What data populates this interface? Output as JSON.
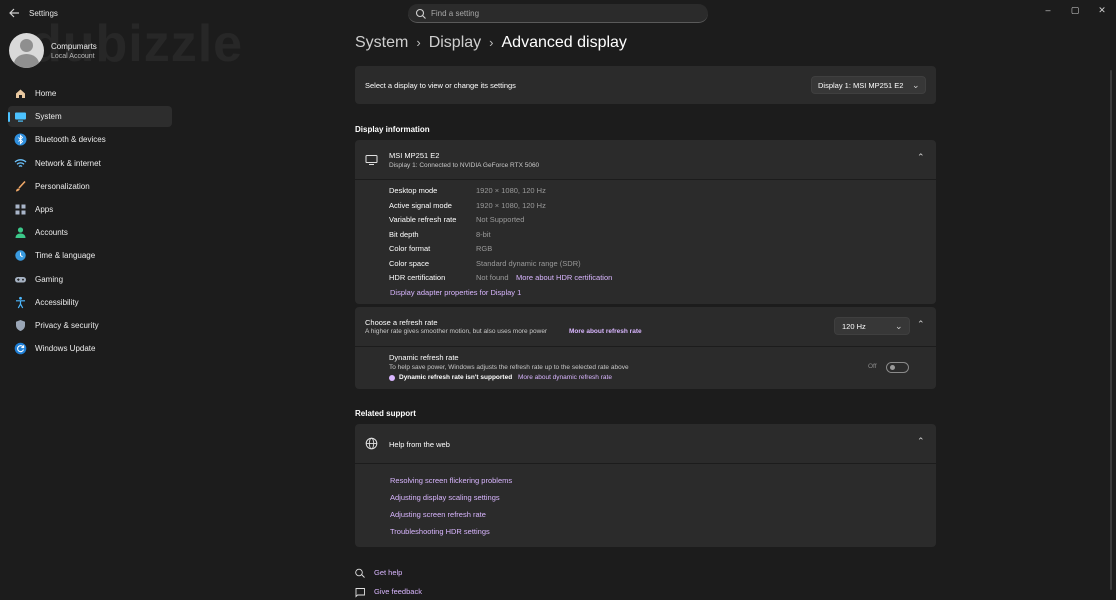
{
  "app": {
    "title": "Settings"
  },
  "search": {
    "placeholder": "Find a setting"
  },
  "window_controls": {
    "minimize": "–",
    "maximize": "▢",
    "close": "✕"
  },
  "watermark": "dubizzle",
  "profile": {
    "name": "Compumarts",
    "account_type": "Local Account"
  },
  "nav": [
    {
      "label": "Home",
      "icon": "home-icon"
    },
    {
      "label": "System",
      "icon": "monitor-icon",
      "active": true
    },
    {
      "label": "Bluetooth & devices",
      "icon": "bluetooth-icon"
    },
    {
      "label": "Network & internet",
      "icon": "wifi-icon"
    },
    {
      "label": "Personalization",
      "icon": "brush-icon"
    },
    {
      "label": "Apps",
      "icon": "apps-icon"
    },
    {
      "label": "Accounts",
      "icon": "person-icon"
    },
    {
      "label": "Time & language",
      "icon": "globe-clock-icon"
    },
    {
      "label": "Gaming",
      "icon": "gamepad-icon"
    },
    {
      "label": "Accessibility",
      "icon": "accessibility-icon"
    },
    {
      "label": "Privacy & security",
      "icon": "shield-icon"
    },
    {
      "label": "Windows Update",
      "icon": "update-icon"
    }
  ],
  "breadcrumb": {
    "part1": "System",
    "part2": "Display",
    "current": "Advanced display",
    "separator": "›"
  },
  "display_select": {
    "label": "Select a display to view or change its settings",
    "value": "Display 1: MSI MP251 E2"
  },
  "display_info": {
    "heading": "Display information",
    "monitor_name": "MSI MP251 E2",
    "monitor_sub": "Display 1: Connected to NVIDIA GeForce RTX 5060",
    "rows": [
      {
        "label": "Desktop mode",
        "value": "1920 × 1080, 120 Hz"
      },
      {
        "label": "Active signal mode",
        "value": "1920 × 1080, 120 Hz"
      },
      {
        "label": "Variable refresh rate",
        "value": "Not Supported"
      },
      {
        "label": "Bit depth",
        "value": "8-bit"
      },
      {
        "label": "Color format",
        "value": "RGB"
      },
      {
        "label": "Color space",
        "value": "Standard dynamic range (SDR)"
      },
      {
        "label": "HDR certification",
        "value": "Not found",
        "link": "More about HDR certification"
      }
    ],
    "adapter_link": "Display adapter properties for Display 1"
  },
  "refresh": {
    "title": "Choose a refresh rate",
    "desc": "A higher rate gives smoother motion, but also uses more power",
    "desc_link": "More about refresh rate",
    "value": "120 Hz",
    "dynamic_title": "Dynamic refresh rate",
    "dynamic_desc": "To help save power, Windows adjusts the refresh rate up to the selected rate above",
    "dynamic_warning": "Dynamic refresh rate isn't supported",
    "dynamic_link": "More about dynamic refresh rate",
    "toggle_state": "Off"
  },
  "related": {
    "heading": "Related support",
    "help_title": "Help from the web",
    "links": [
      "Resolving screen flickering problems",
      "Adjusting display scaling settings",
      "Adjusting screen refresh rate",
      "Troubleshooting HDR settings"
    ]
  },
  "footer": {
    "get_help": "Get help",
    "give_feedback": "Give feedback"
  },
  "colors": {
    "accent": "#4cc2ff",
    "link": "#d9b6ff",
    "card": "#2b2b2b",
    "background": "#1c1c1c"
  }
}
